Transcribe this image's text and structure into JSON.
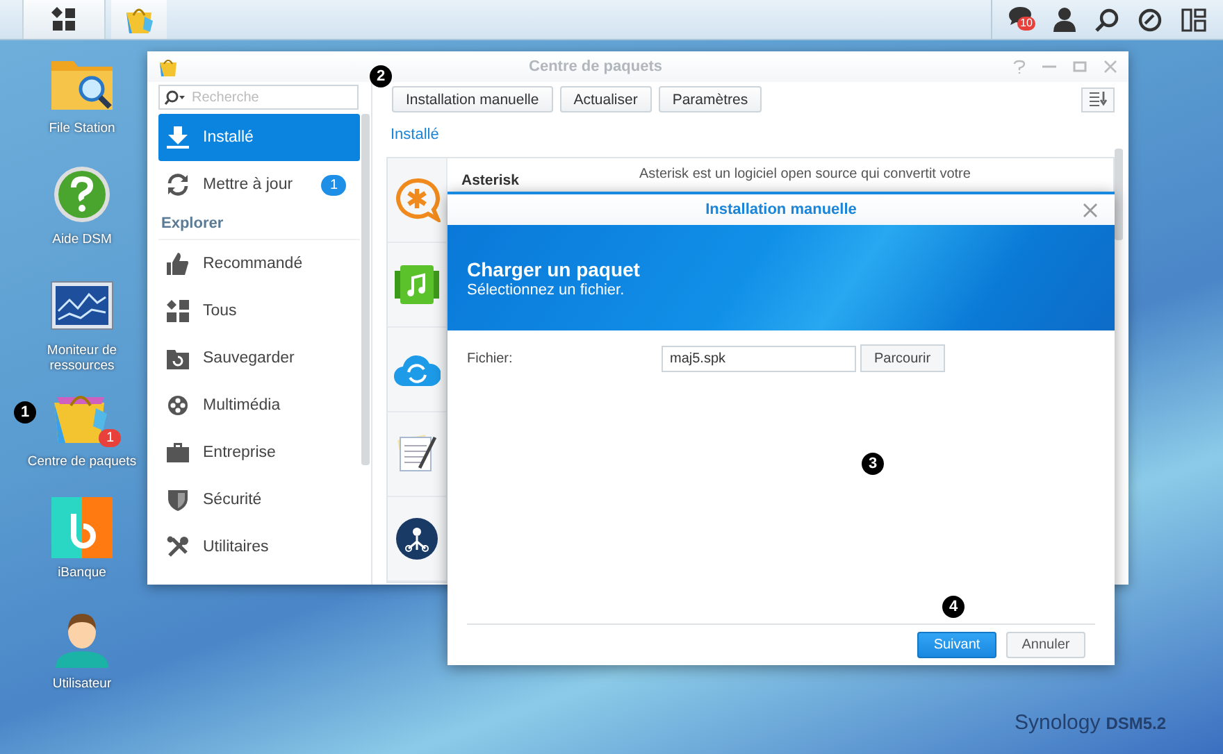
{
  "taskbar": {
    "notification_badge": "10"
  },
  "desktop_icons": [
    {
      "kind": "file-station",
      "label": "File Station"
    },
    {
      "kind": "help",
      "label": "Aide DSM"
    },
    {
      "kind": "monitor",
      "label": "Moniteur de ressources"
    },
    {
      "kind": "package",
      "label": "Centre de paquets",
      "badge": "1"
    },
    {
      "kind": "bank",
      "label": "iBanque"
    },
    {
      "kind": "user",
      "label": "Utilisateur"
    }
  ],
  "window": {
    "title": "Centre de paquets",
    "search": {
      "placeholder": "Recherche"
    },
    "nav": [
      {
        "kind": "installed",
        "label": "Installé",
        "selected": true
      },
      {
        "kind": "update",
        "label": "Mettre à jour",
        "badge": "1",
        "selected": false
      }
    ],
    "section_title": "Explorer",
    "categories": [
      {
        "kind": "recommended",
        "label": "Recommandé",
        "selected": false
      },
      {
        "kind": "all",
        "label": "Tous",
        "selected": false
      },
      {
        "kind": "backup",
        "label": "Sauvegarder",
        "selected": false
      },
      {
        "kind": "multimedia",
        "label": "Multimédia",
        "selected": false
      },
      {
        "kind": "business",
        "label": "Entreprise",
        "selected": false
      },
      {
        "kind": "security",
        "label": "Sécurité",
        "selected": false
      },
      {
        "kind": "utilities",
        "label": "Utilitaires",
        "selected": false
      }
    ],
    "toolbar": [
      "Installation manuelle",
      "Actualiser",
      "Paramètres"
    ],
    "list_heading": "Installé",
    "packages": [
      {
        "kind": "asterisk",
        "name": "Asterisk",
        "description": "Asterisk est un logiciel open source qui convertit votre"
      },
      {
        "kind": "audio"
      },
      {
        "kind": "cloud-sync"
      },
      {
        "kind": "notes"
      },
      {
        "kind": "network"
      }
    ]
  },
  "dialog": {
    "title": "Installation manuelle",
    "banner_title": "Charger un paquet",
    "banner_subtitle": "Sélectionnez un fichier.",
    "field_label": "Fichier:",
    "field_value": "maj5.spk",
    "browse_button": "Parcourir",
    "buttons": [
      {
        "kind": "primary",
        "label": "Suivant"
      },
      {
        "kind": "secondary",
        "label": "Annuler"
      }
    ]
  },
  "callouts": [
    "1",
    "2",
    "3",
    "4"
  ],
  "branding": {
    "name": "Synology",
    "version": "DSM5.2"
  }
}
